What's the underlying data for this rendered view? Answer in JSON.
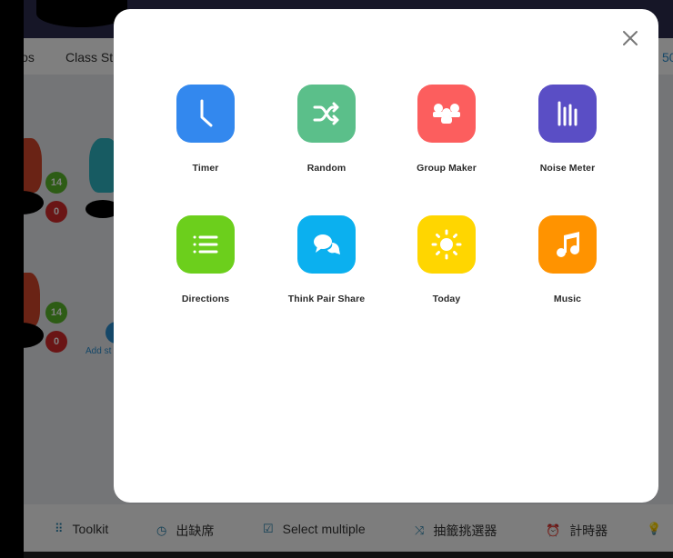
{
  "nav": {
    "items": [
      "ios",
      "Class St"
    ],
    "points": "50"
  },
  "students": [
    {
      "positive": "14",
      "negative": "0"
    },
    {
      "positive": "14",
      "negative": "0"
    }
  ],
  "add_student": "Add st",
  "toolbar": {
    "items": [
      {
        "icon": "grid-icon",
        "label": "Toolkit"
      },
      {
        "icon": "clock-icon",
        "label": "出缺席"
      },
      {
        "icon": "checkbox-icon",
        "label": "Select multiple"
      },
      {
        "icon": "shuffle-icon",
        "label": "抽籤挑選器"
      },
      {
        "icon": "alarm-icon",
        "label": "計時器"
      }
    ]
  },
  "modal": {
    "tools": [
      {
        "label": "Timer",
        "icon": "clock-icon",
        "color": "#3388ee"
      },
      {
        "label": "Random",
        "icon": "shuffle-icon",
        "color": "#5bbf8a"
      },
      {
        "label": "Group Maker",
        "icon": "group-icon",
        "color": "#fc5e5e"
      },
      {
        "label": "Noise Meter",
        "icon": "bars-icon",
        "color": "#5a4ec5"
      },
      {
        "label": "Directions",
        "icon": "list-icon",
        "color": "#6ccf1c"
      },
      {
        "label": "Think Pair Share",
        "icon": "chat-bubbles-icon",
        "color": "#0bb0ef"
      },
      {
        "label": "Today",
        "icon": "sun-icon",
        "color": "#ffd600"
      },
      {
        "label": "Music",
        "icon": "music-note-icon",
        "color": "#ff9300"
      }
    ]
  }
}
